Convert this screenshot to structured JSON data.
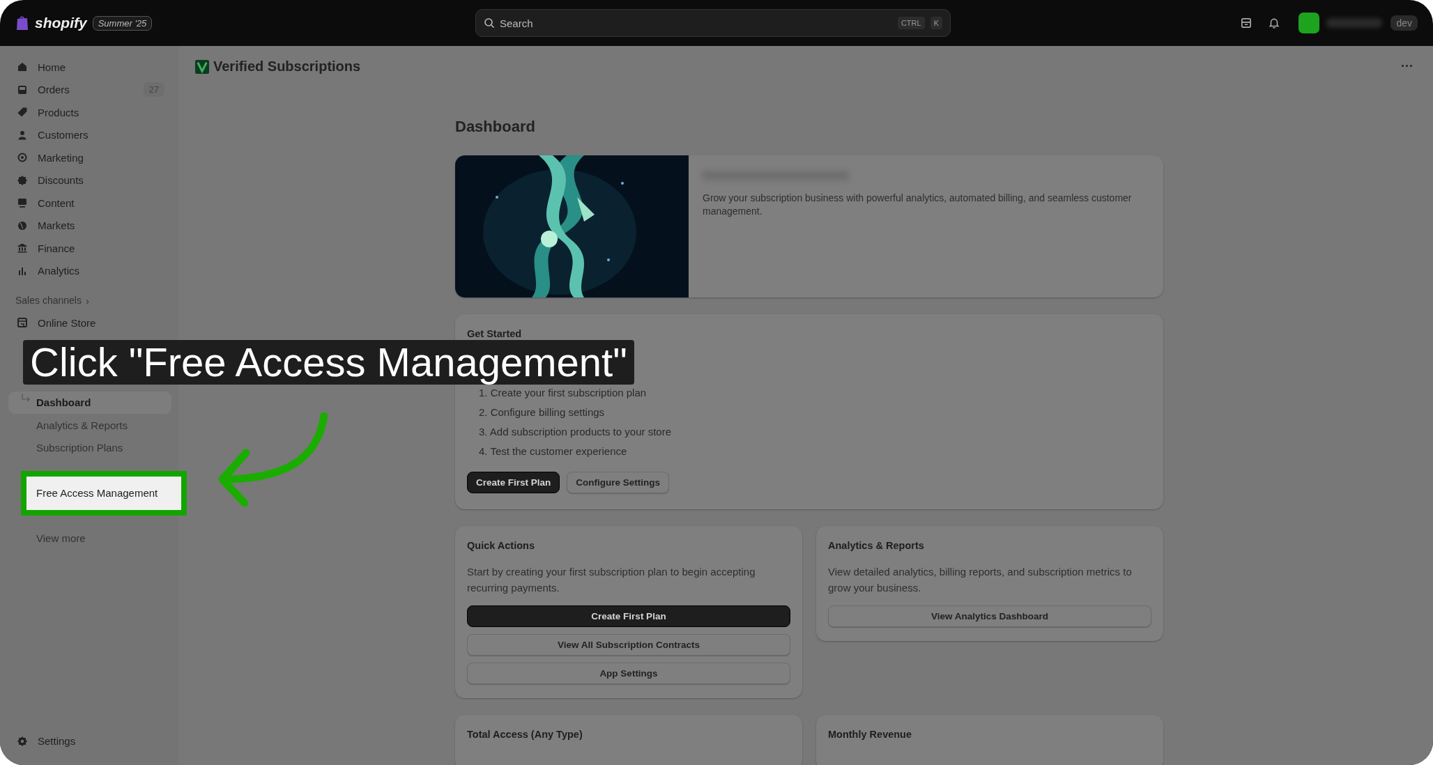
{
  "topbar": {
    "brand": "shopify",
    "edition": "Summer '25",
    "search": {
      "placeholder": "Search",
      "keys": [
        "CTRL",
        "K"
      ]
    },
    "user_badge": "dev"
  },
  "sidebar": {
    "items": [
      {
        "label": "Home"
      },
      {
        "label": "Orders",
        "count": "27"
      },
      {
        "label": "Products"
      },
      {
        "label": "Customers"
      },
      {
        "label": "Marketing"
      },
      {
        "label": "Discounts"
      },
      {
        "label": "Content"
      },
      {
        "label": "Markets"
      },
      {
        "label": "Finance"
      },
      {
        "label": "Analytics"
      }
    ],
    "sales_channels": {
      "heading": "Sales channels",
      "chevron": "›",
      "items": [
        {
          "label": "Online Store"
        }
      ]
    },
    "app_items": [
      {
        "kind": "link",
        "label": "Dashboard",
        "selected": true,
        "highlighted": false
      },
      {
        "kind": "link",
        "label": "Analytics & Reports",
        "selected": false,
        "highlighted": false
      },
      {
        "kind": "link",
        "label": "Subscription Plans",
        "selected": false,
        "highlighted": false
      },
      {
        "kind": "covered"
      },
      {
        "kind": "link",
        "label": "Free Access Management",
        "selected": false,
        "highlighted": true
      },
      {
        "kind": "covered"
      },
      {
        "kind": "link",
        "label": "View more",
        "selected": false,
        "highlighted": false
      }
    ],
    "settings": "Settings"
  },
  "page": {
    "title": "Verified Subscriptions",
    "more": "···",
    "heading": "Dashboard",
    "banner": {
      "text": "Grow your subscription business with powerful analytics, automated billing, and seamless customer management."
    },
    "get_started": {
      "title": "Get Started",
      "steps": [
        "1. Create your first subscription plan",
        "2. Configure billing settings",
        "3. Add subscription products to your store",
        "4. Test the customer experience"
      ],
      "buttons": [
        {
          "label": "Create First Plan",
          "kind": "primary"
        },
        {
          "label": "Configure Settings",
          "kind": "secondary"
        }
      ]
    },
    "cards": [
      {
        "title": "Quick Actions",
        "text": "Start by creating your first subscription plan to begin accepting recurring payments.",
        "buttons": [
          {
            "label": "Create First Plan",
            "kind": "primary"
          },
          {
            "label": "View All Subscription Contracts",
            "kind": "secondary"
          },
          {
            "label": "App Settings",
            "kind": "secondary"
          }
        ]
      },
      {
        "title": "Analytics & Reports",
        "text": "View detailed analytics, billing reports, and subscription metrics to grow your business.",
        "buttons": [
          {
            "label": "View Analytics Dashboard",
            "kind": "secondary"
          }
        ]
      }
    ],
    "stat_cards": [
      {
        "title": "Total Access (Any Type)"
      },
      {
        "title": "Monthly Revenue"
      }
    ]
  },
  "tutorial": {
    "caption": "Click \"Free Access Management\""
  }
}
